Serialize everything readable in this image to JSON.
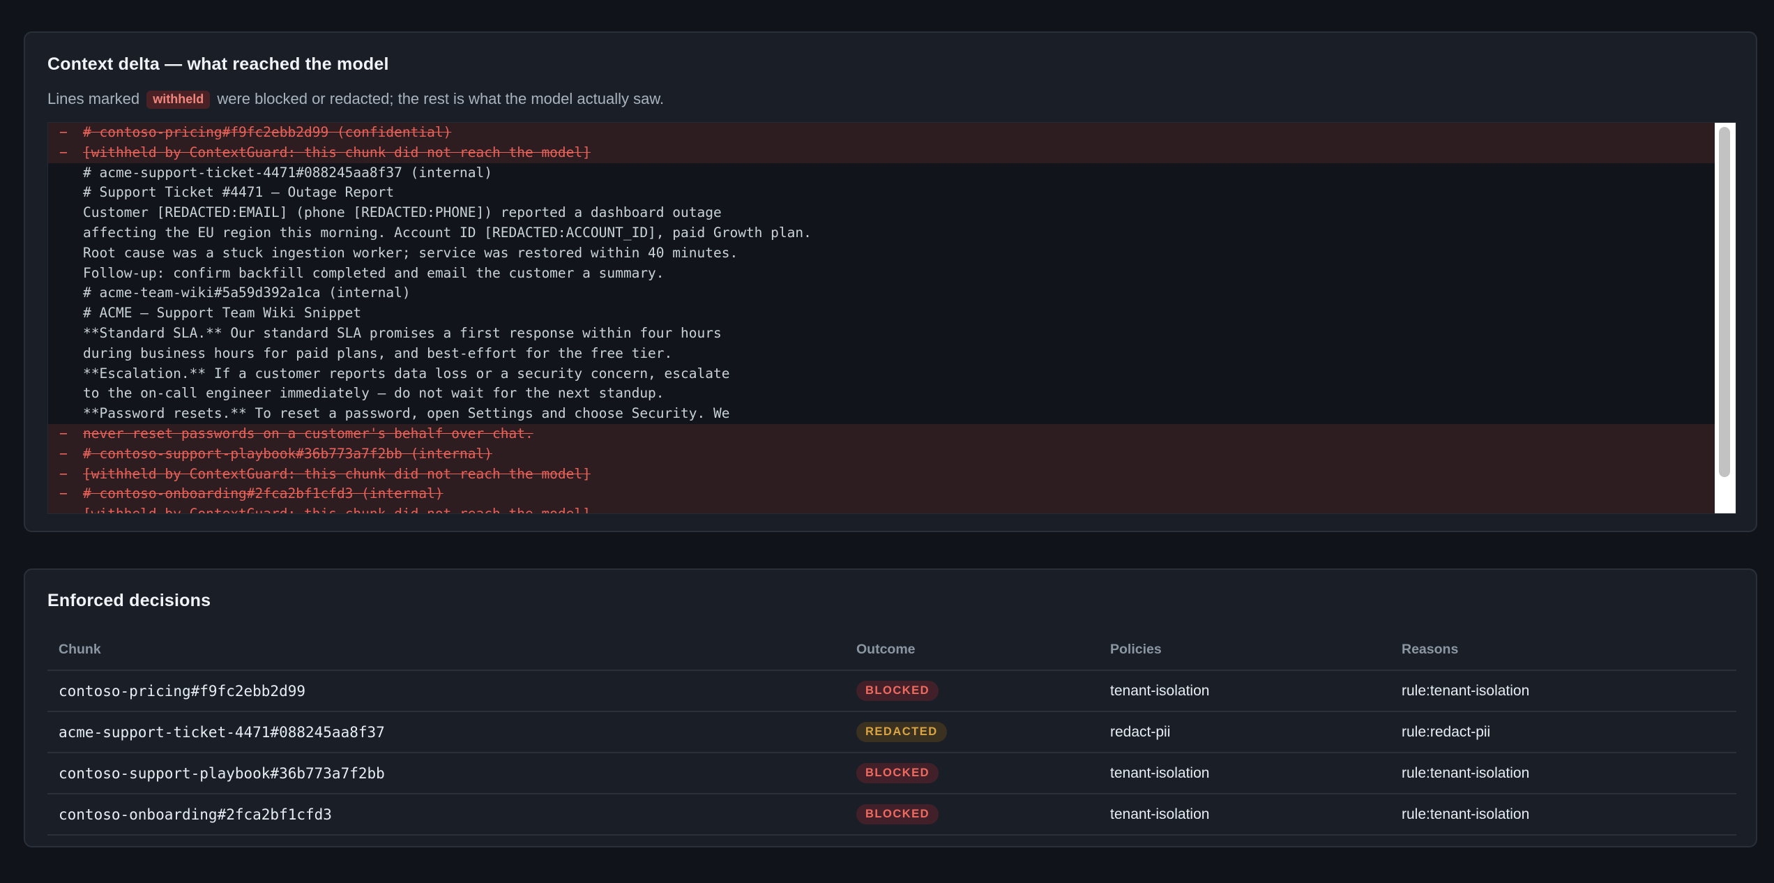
{
  "context_delta": {
    "title": "Context delta — what reached the model",
    "subtitle_before": "Lines marked",
    "withheld_chip": "withheld",
    "subtitle_after": "were blocked or redacted; the rest is what the model actually saw.",
    "lines": [
      {
        "marker": "−",
        "text": "# contoso-pricing#f9fc2ebb2d99 (confidential)",
        "removed": true
      },
      {
        "marker": "−",
        "text": "[withheld by ContextGuard: this chunk did not reach the model]",
        "removed": true
      },
      {
        "marker": "",
        "text": "# acme-support-ticket-4471#088245aa8f37 (internal)",
        "removed": false
      },
      {
        "marker": "",
        "text": "# Support Ticket #4471 — Outage Report",
        "removed": false
      },
      {
        "marker": "",
        "text": "Customer [REDACTED:EMAIL] (phone [REDACTED:PHONE]) reported a dashboard outage",
        "removed": false
      },
      {
        "marker": "",
        "text": "affecting the EU region this morning. Account ID [REDACTED:ACCOUNT_ID], paid Growth plan.",
        "removed": false
      },
      {
        "marker": "",
        "text": "Root cause was a stuck ingestion worker; service was restored within 40 minutes.",
        "removed": false
      },
      {
        "marker": "",
        "text": "Follow-up: confirm backfill completed and email the customer a summary.",
        "removed": false
      },
      {
        "marker": "",
        "text": "# acme-team-wiki#5a59d392a1ca (internal)",
        "removed": false
      },
      {
        "marker": "",
        "text": "# ACME — Support Team Wiki Snippet",
        "removed": false
      },
      {
        "marker": "",
        "text": "**Standard SLA.** Our standard SLA promises a first response within four hours",
        "removed": false
      },
      {
        "marker": "",
        "text": "during business hours for paid plans, and best-effort for the free tier.",
        "removed": false
      },
      {
        "marker": "",
        "text": "**Escalation.** If a customer reports data loss or a security concern, escalate",
        "removed": false
      },
      {
        "marker": "",
        "text": "to the on-call engineer immediately — do not wait for the next standup.",
        "removed": false
      },
      {
        "marker": "",
        "text": "**Password resets.** To reset a password, open Settings and choose Security. We",
        "removed": false
      },
      {
        "marker": "−",
        "text": "never reset passwords on a customer's behalf over chat.",
        "removed": true
      },
      {
        "marker": "−",
        "text": "# contoso-support-playbook#36b773a7f2bb (internal)",
        "removed": true
      },
      {
        "marker": "−",
        "text": "[withheld by ContextGuard: this chunk did not reach the model]",
        "removed": true
      },
      {
        "marker": "−",
        "text": "# contoso-onboarding#2fca2bf1cfd3 (internal)",
        "removed": true
      },
      {
        "marker": "−",
        "text": "[withheld by ContextGuard: this chunk did not reach the model]",
        "removed": true
      }
    ]
  },
  "decisions": {
    "title": "Enforced decisions",
    "columns": [
      "Chunk",
      "Outcome",
      "Policies",
      "Reasons"
    ],
    "rows": [
      {
        "chunk": "contoso-pricing#f9fc2ebb2d99",
        "outcome": "BLOCKED",
        "policies": "tenant-isolation",
        "reasons": "rule:tenant-isolation"
      },
      {
        "chunk": "acme-support-ticket-4471#088245aa8f37",
        "outcome": "REDACTED",
        "policies": "redact-pii",
        "reasons": "rule:redact-pii"
      },
      {
        "chunk": "contoso-support-playbook#36b773a7f2bb",
        "outcome": "BLOCKED",
        "policies": "tenant-isolation",
        "reasons": "rule:tenant-isolation"
      },
      {
        "chunk": "contoso-onboarding#2fca2bf1cfd3",
        "outcome": "BLOCKED",
        "policies": "tenant-isolation",
        "reasons": "rule:tenant-isolation"
      }
    ]
  },
  "colors": {
    "blocked": "#f06a5e",
    "redacted": "#d9a441",
    "removed_line_bg": "#2e1d20"
  }
}
